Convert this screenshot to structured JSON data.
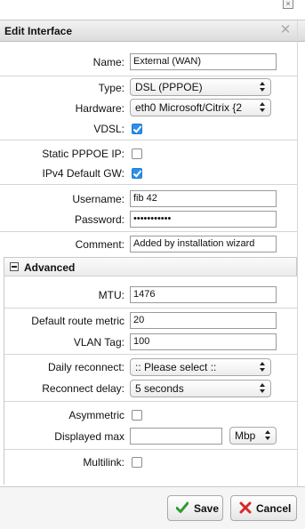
{
  "dialog": {
    "title": "Edit Interface"
  },
  "form": {
    "name_label": "Name:",
    "name_value": "External (WAN)",
    "type_label": "Type:",
    "type_value": "DSL (PPPOE)",
    "hardware_label": "Hardware:",
    "hardware_value": "eth0 Microsoft/Citrix {2",
    "vdsl_label": "VDSL:",
    "static_pppoe_label": "Static PPPOE IP:",
    "ipv4_gw_label": "IPv4 Default GW:",
    "username_label": "Username:",
    "username_value": "fib            42",
    "password_label": "Password:",
    "password_value": "•••••••••••",
    "comment_label": "Comment:",
    "comment_value": "Added by installation wizard"
  },
  "advanced": {
    "title": "Advanced",
    "mtu_label": "MTU:",
    "mtu_value": "1476",
    "default_route_metric_label": "Default route metric",
    "default_route_metric_value": "20",
    "vlan_tag_label": "VLAN Tag:",
    "vlan_tag_value": "100",
    "daily_reconnect_label": "Daily reconnect:",
    "daily_reconnect_value": ":: Please select ::",
    "reconnect_delay_label": "Reconnect delay:",
    "reconnect_delay_value": "5 seconds",
    "asymmetric_label": "Asymmetric",
    "displayed_max_label": "Displayed max",
    "displayed_max_value": "",
    "displayed_max_unit": "Mbp",
    "multilink_label": "Multilink:"
  },
  "footer": {
    "save_label": "Save",
    "cancel_label": "Cancel"
  },
  "colors": {
    "checkbox_on": "#2b8fe6",
    "save_check": "#2e9d2e",
    "cancel_x": "#d42a2a"
  },
  "checkboxes": {
    "vdsl": true,
    "static_pppoe": false,
    "ipv4_default_gw": true,
    "asymmetric": false,
    "multilink": false
  }
}
